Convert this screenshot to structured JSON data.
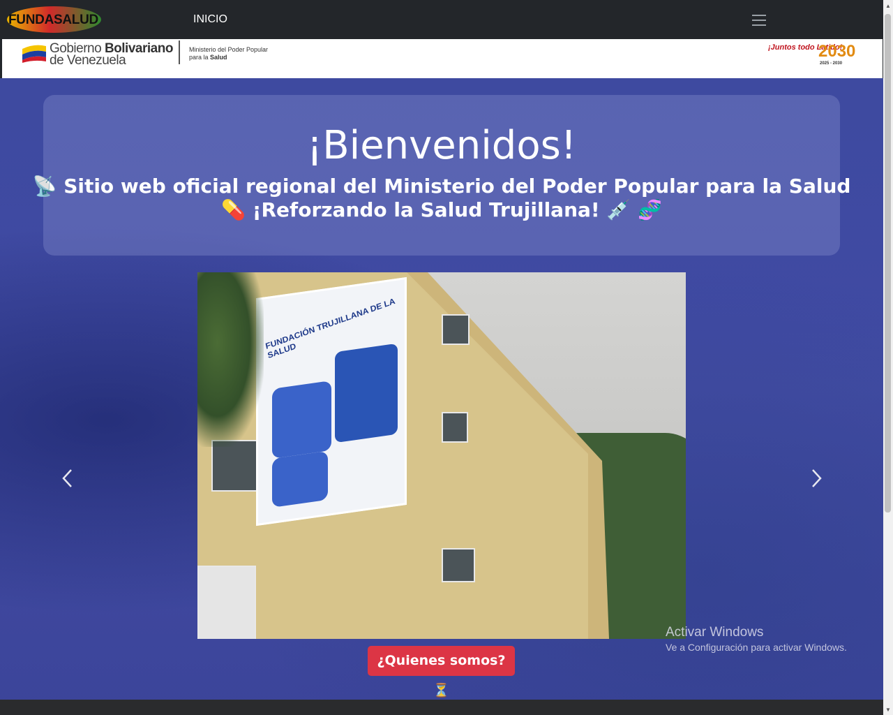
{
  "navbar": {
    "brand": "FUNDASALUD",
    "links": [
      {
        "label": "INICIO"
      }
    ],
    "toggler_icon": "hamburger-icon"
  },
  "banner": {
    "gob_line1_a": "Gobierno ",
    "gob_line1_b": "Bolivariano",
    "gob_line2": "de Venezuela",
    "ministry_line1": "Ministerio del Poder Popular",
    "ministry_line2_a": "para la ",
    "ministry_line2_b": "Salud",
    "right_logo_1": "¡Juntos todo Latido!",
    "right_logo_2": "2030",
    "right_logo_2_sub": "2025 - 2030"
  },
  "hero": {
    "title": "¡Bienvenidos!",
    "subtitle_line1": "📡 Sitio web oficial regional del Ministerio del Poder Popular para la Salud",
    "subtitle_line2": "💊 ¡Reforzando la Salud Trujillana! 💉 🧬",
    "carousel": {
      "slide_sign_text": "FUNDACIÓN TRUJILLANA DE LA SALUD",
      "prev_icon": "chevron-left-icon",
      "next_icon": "chevron-right-icon"
    },
    "cta_label": "¿Quienes somos? ⏳"
  },
  "watermark": {
    "line1": "Activar Windows",
    "line2": "Ve a Configuración para activar Windows."
  },
  "colors": {
    "navbar": "#23262a",
    "hero_blue": "#3c449c",
    "cta_red": "#dc3545"
  }
}
